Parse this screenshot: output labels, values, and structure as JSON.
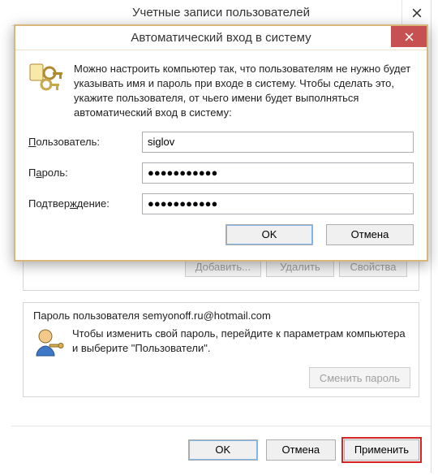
{
  "parent": {
    "title": "Учетные записи пользователей",
    "add": "Добавить...",
    "remove": "Удалить",
    "props": "Свойства",
    "pwd_caption_prefix": "Пароль пользователя ",
    "pwd_caption_user": "semyonoff.ru@hotmail.com",
    "pwd_text": "Чтобы изменить свой пароль, перейдите к параметрам компьютера и выберите \"Пользователи\".",
    "change_pwd": "Сменить пароль",
    "ok": "OK",
    "cancel": "Отмена",
    "apply": "Применить"
  },
  "modal": {
    "title": "Автоматический вход в систему",
    "intro": "Можно настроить компьютер так, что пользователям не нужно будет указывать имя и пароль при входе в систему. Чтобы сделать это, укажите пользователя, от чьего имени будет выполняться автоматический вход в систему:",
    "user_label_pre": "",
    "user_label_ul": "П",
    "user_label_post": "ользователь:",
    "user_value": "siglov",
    "pass_label_pre": "П",
    "pass_label_ul": "а",
    "pass_label_post": "роль:",
    "pass_value": "●●●●●●●●●●●",
    "conf_label_pre": "Подтвер",
    "conf_label_ul": "ж",
    "conf_label_post": "дение:",
    "conf_value": "●●●●●●●●●●●",
    "ok": "OK",
    "cancel": "Отмена"
  }
}
